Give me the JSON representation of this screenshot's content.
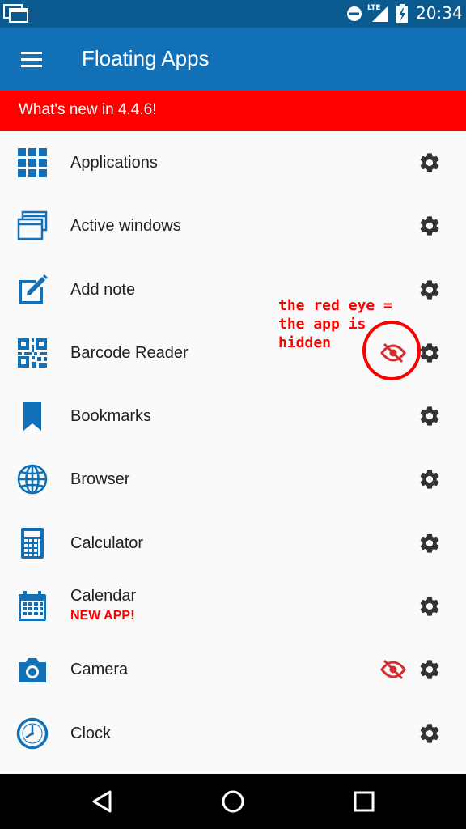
{
  "status_bar": {
    "network": "LTE",
    "time": "20:34"
  },
  "app_bar": {
    "title": "Floating Apps",
    "menu_icon": "hamburger-menu-icon"
  },
  "banner": {
    "text": "What's new in 4.4.6!",
    "color": "#ff0000"
  },
  "colors": {
    "status_bar": "#0a5a8f",
    "app_bar": "#1170b6",
    "icon_blue": "#1170b6",
    "hidden_eye": "#d32f2f",
    "settings_gear": "#333333"
  },
  "apps": [
    {
      "label": "Applications",
      "icon": "apps-grid-icon",
      "hidden": false
    },
    {
      "label": "Active windows",
      "icon": "windows-icon",
      "hidden": false
    },
    {
      "label": "Add note",
      "icon": "edit-note-icon",
      "hidden": false
    },
    {
      "label": "Barcode Reader",
      "icon": "qr-code-icon",
      "hidden": true
    },
    {
      "label": "Bookmarks",
      "icon": "bookmark-icon",
      "hidden": false
    },
    {
      "label": "Browser",
      "icon": "globe-icon",
      "hidden": false
    },
    {
      "label": "Calculator",
      "icon": "calculator-icon",
      "hidden": false
    },
    {
      "label": "Calendar",
      "icon": "calendar-icon",
      "hidden": false,
      "badge": "NEW APP!"
    },
    {
      "label": "Camera",
      "icon": "camera-icon",
      "hidden": true
    },
    {
      "label": "Clock",
      "icon": "clock-icon",
      "hidden": false
    }
  ],
  "annotation": {
    "text": "the red eye =\nthe app is\nhidden"
  },
  "nav_bar": {
    "back_icon": "back-triangle-icon",
    "home_icon": "home-circle-icon",
    "recents_icon": "recents-square-icon"
  }
}
